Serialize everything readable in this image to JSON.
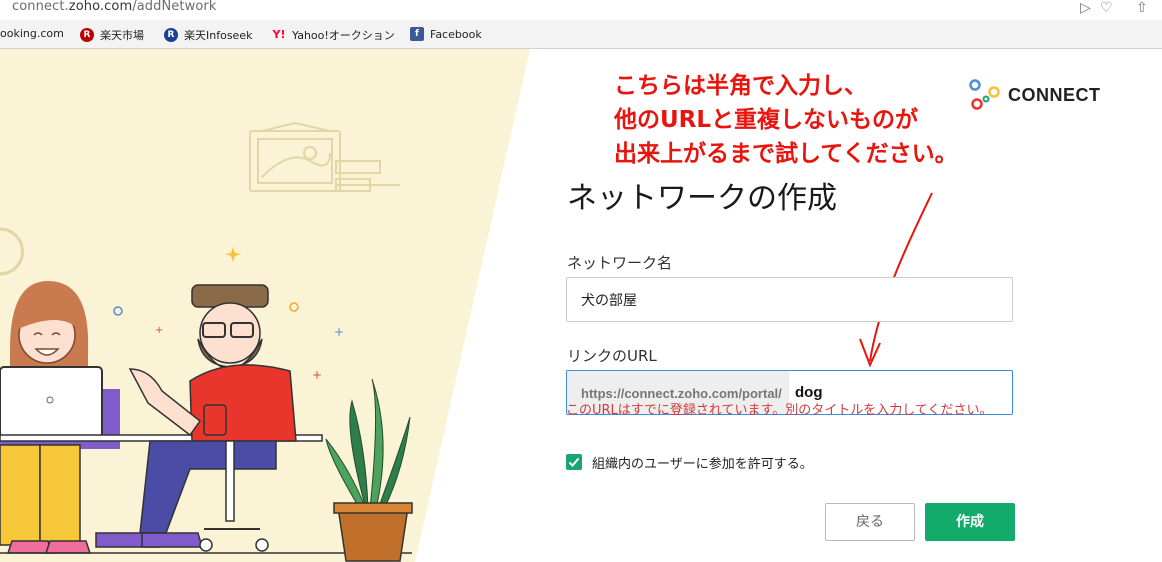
{
  "browser": {
    "url_prefix": "connect.",
    "url_domain": "zoho.com",
    "url_path": "/addNetwork",
    "bookmarks": [
      {
        "label": "ooking.com",
        "icon": "booking-icon"
      },
      {
        "label": "楽天市場",
        "icon": "rakuten-icon",
        "color": "#bf0000"
      },
      {
        "label": "楽天Infoseek",
        "icon": "infoseek-icon",
        "color": "#1c3f94"
      },
      {
        "label": "Yahoo!オークション",
        "icon": "yahoo-icon",
        "color": "#ff0033"
      },
      {
        "label": "Facebook",
        "icon": "facebook-icon",
        "color": "#3b5998"
      }
    ]
  },
  "logo": {
    "text": "CONNECT"
  },
  "annotation": {
    "lines": [
      "こちらは半角で入力し、",
      "他のURLと重複しないものが",
      "出来上がるまで試してください。"
    ],
    "color": "#e8140e"
  },
  "form": {
    "title": "ネットワークの作成",
    "name_label": "ネットワーク名",
    "name_value": "犬の部屋",
    "url_label": "リンクのURL",
    "url_prefix": "https://connect.zoho.com/portal/",
    "url_value": "dog",
    "error": "このURLはすでに登録されています。別のタイトルを入力してください。",
    "checkbox_label": "組織内のユーザーに参加を許可する。",
    "checkbox_checked": true,
    "back_label": "戻る",
    "create_label": "作成"
  },
  "colors": {
    "accent": "#13ab6c",
    "error": "#d13b3b",
    "illustration_bg": "#fbf3d5"
  }
}
